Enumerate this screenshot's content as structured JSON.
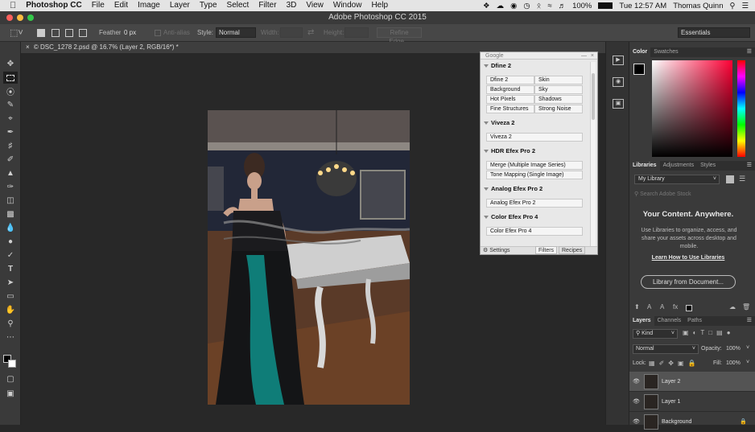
{
  "menubar": {
    "app_name": "Photoshop CC",
    "items": [
      "File",
      "Edit",
      "Image",
      "Layer",
      "Type",
      "Select",
      "Filter",
      "3D",
      "View",
      "Window",
      "Help"
    ],
    "battery": "100%",
    "clock": "Tue 12:57 AM",
    "user": "Thomas Quinn"
  },
  "window": {
    "title": "Adobe Photoshop CC 2015"
  },
  "options": {
    "feather_label": "Feather:",
    "feather_value": "0 px",
    "antialias_label": "Anti-alias",
    "style_label": "Style:",
    "style_value": "Normal",
    "width_label": "Width:",
    "height_label": "Height:",
    "refine_label": "Refine Edge...",
    "workspace": "Essentials"
  },
  "document": {
    "tab_title": "© DSC_1278 2.psd @ 16.7% (Layer 2, RGB/16*) *"
  },
  "google": {
    "title": "Google",
    "sections": [
      {
        "name": "Dfine 2",
        "items": [
          "Dfine 2",
          "Skin",
          "Background",
          "Sky",
          "Hot Pixels",
          "Shadows",
          "Fine Structures",
          "Strong Noise"
        ]
      },
      {
        "name": "Viveza 2",
        "items": [
          "Viveza 2"
        ]
      },
      {
        "name": "HDR Efex Pro 2",
        "items": [
          "Merge (Multiple Image Series)",
          "Tone Mapping (Single Image)"
        ]
      },
      {
        "name": "Analog Efex Pro 2",
        "items": [
          "Analog Efex Pro 2"
        ]
      },
      {
        "name": "Color Efex Pro 4",
        "items": [
          "Color Efex Pro 4"
        ]
      }
    ],
    "footer_settings": "Settings",
    "footer_filters": "Filters",
    "footer_recipes": "Recipes"
  },
  "color_panel": {
    "tabs": [
      "Color",
      "Swatches"
    ]
  },
  "libraries": {
    "tabs": [
      "Libraries",
      "Adjustments",
      "Styles"
    ],
    "library_name": "My Library",
    "search_placeholder": "Search Adobe Stock",
    "heading": "Your Content. Anywhere.",
    "body": "Use Libraries to organize, access, and share your assets across desktop and mobile.",
    "link": "Learn How to Use Libraries",
    "button": "Library from Document..."
  },
  "layers": {
    "tabs": [
      "Layers",
      "Channels",
      "Paths"
    ],
    "filter_kind": "Kind",
    "blend_mode": "Normal",
    "opacity_label": "Opacity:",
    "opacity_value": "100%",
    "lock_label": "Lock:",
    "fill_label": "Fill:",
    "fill_value": "100%",
    "items": [
      {
        "name": "Layer 2",
        "selected": true
      },
      {
        "name": "Layer 1",
        "selected": false
      },
      {
        "name": "Background",
        "selected": false
      }
    ]
  }
}
